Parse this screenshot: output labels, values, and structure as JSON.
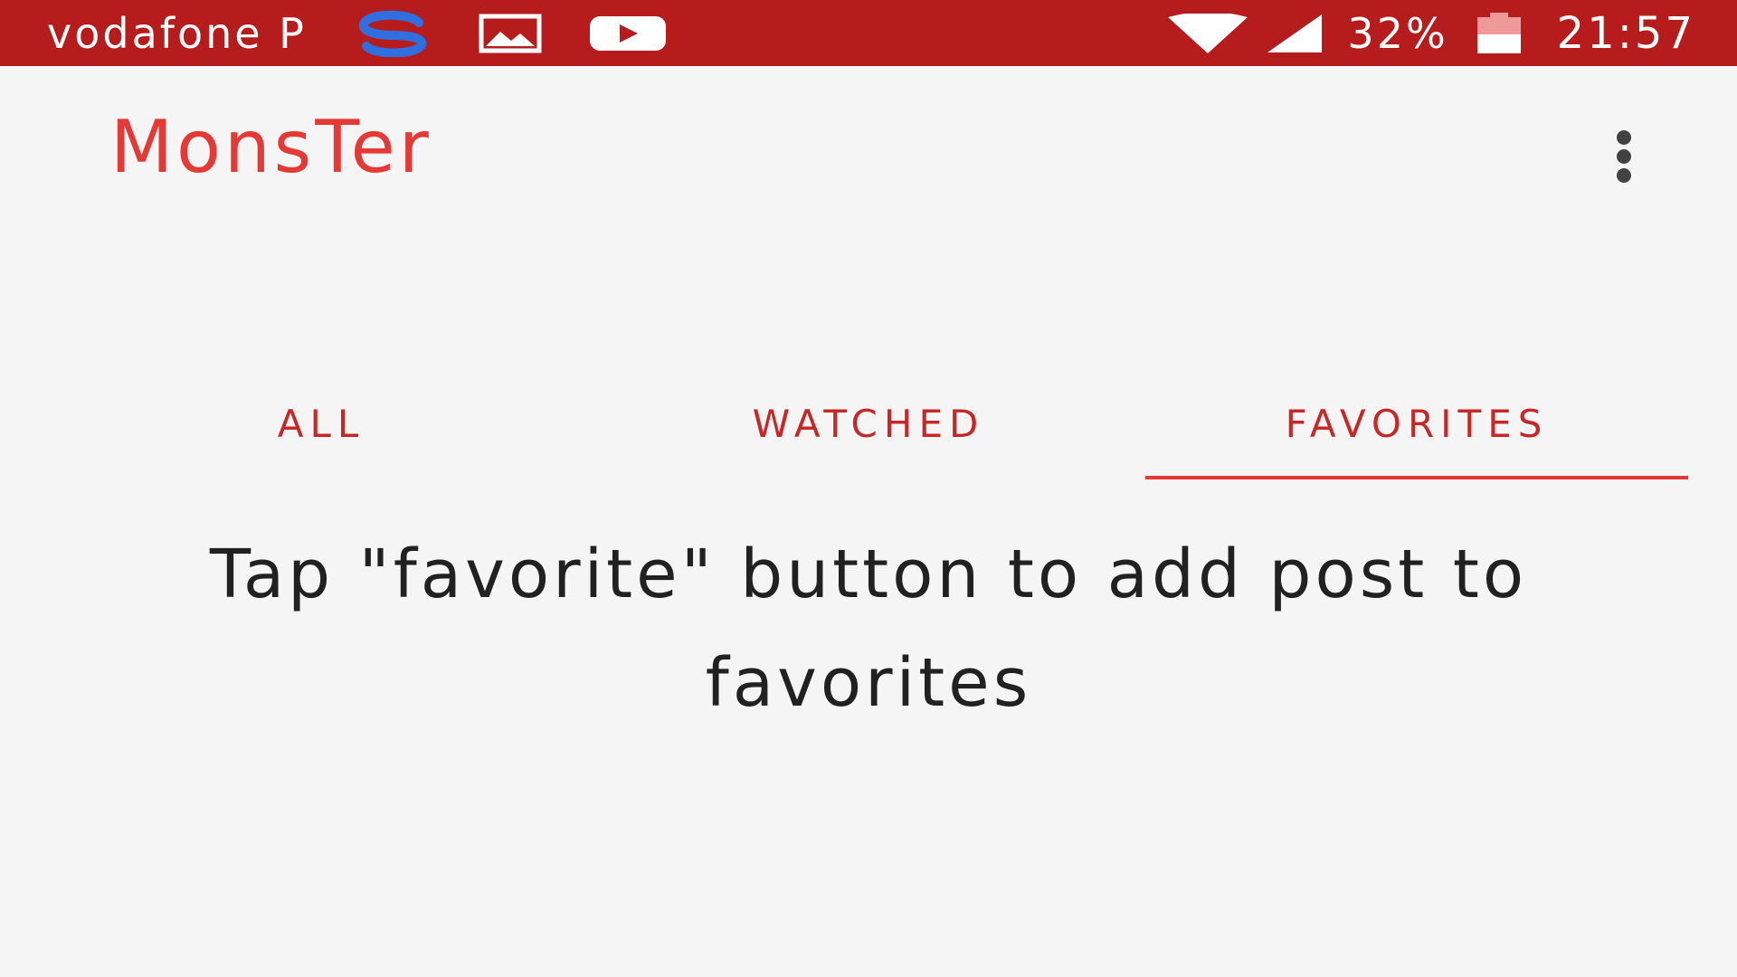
{
  "status_bar": {
    "carrier": "vodafone P",
    "battery_percent": "32%",
    "time": "21:57",
    "background_color": "#b71c1c",
    "notification_icons": [
      "sync-s-icon",
      "gallery-image-icon",
      "youtube-play-icon"
    ],
    "system_icons": [
      "wifi-icon",
      "cell-signal-icon",
      "battery-icon"
    ],
    "accent_blue": "#2f6fe0"
  },
  "app_bar": {
    "title": "MonsTer",
    "title_color": "#e53935",
    "menu_icon": "more-vert-icon"
  },
  "tabs": {
    "items": [
      {
        "label": "ALL",
        "selected": false
      },
      {
        "label": "WATCHED",
        "selected": false
      },
      {
        "label": "FAVORITES",
        "selected": true
      }
    ],
    "text_color": "#c62828",
    "indicator_color": "#e53935"
  },
  "content": {
    "empty_message": "Tap \"favorite\" button to add post to favorites"
  }
}
